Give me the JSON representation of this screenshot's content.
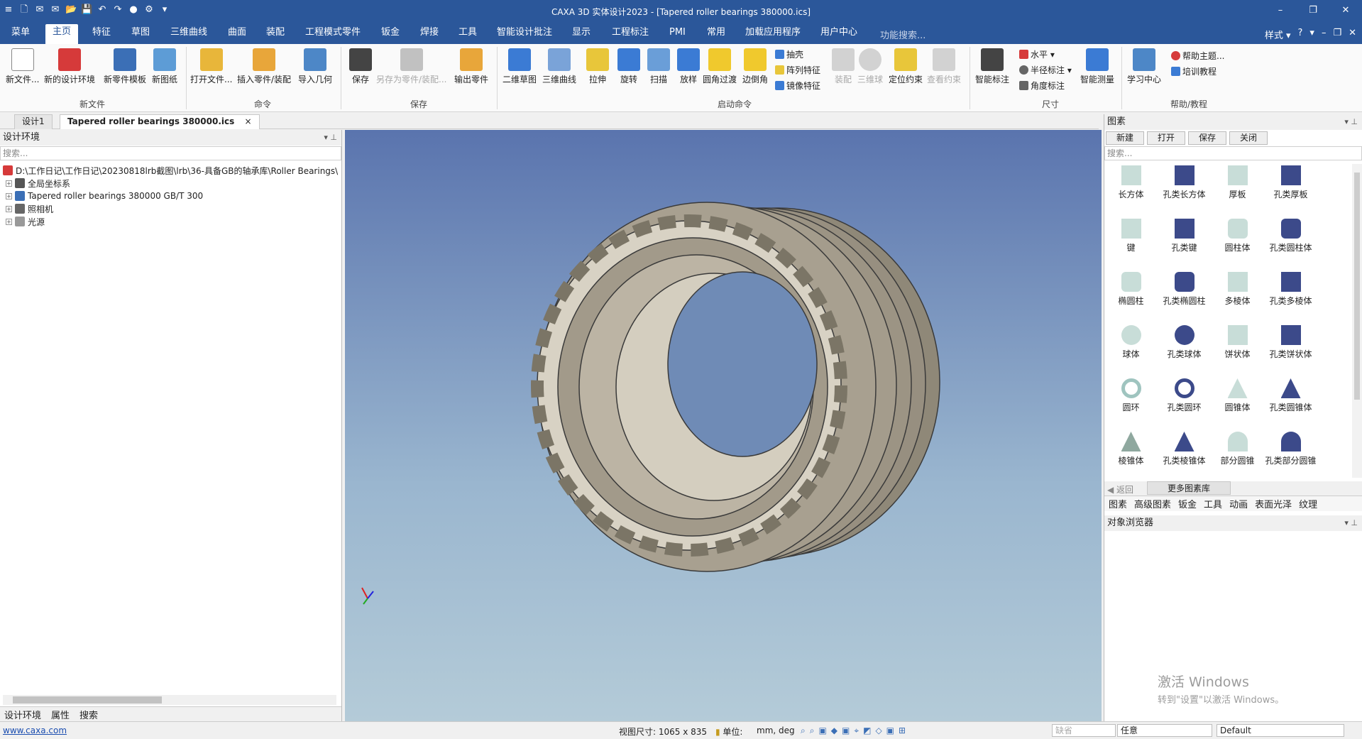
{
  "window": {
    "title": "CAXA 3D 实体设计2023 - [Tapered roller bearings 380000.ics]",
    "min_glyph": "–",
    "restore_glyph": "❐",
    "close_glyph": "✕"
  },
  "quick_access": [
    "≡",
    "🗋",
    "✉",
    "✉",
    "📂",
    "💾",
    "↶",
    "↷",
    "●",
    "⚙",
    "▾"
  ],
  "menu": {
    "tabs": [
      "菜单",
      "主页",
      "特征",
      "草图",
      "三维曲线",
      "曲面",
      "装配",
      "工程模式零件",
      "钣金",
      "焊接",
      "工具",
      "智能设计批注",
      "显示",
      "工程标注",
      "PMI",
      "常用",
      "加载应用程序",
      "用户中心"
    ],
    "active_index": 1,
    "search_placeholder": "功能搜索...",
    "right": [
      "样式 ▾",
      "?",
      "▾",
      "–",
      "❐",
      "✕"
    ]
  },
  "ribbon": {
    "groups": {
      "new": "新文件",
      "command": "命令",
      "save": "保存",
      "launch": "启动命令",
      "dimension": "尺寸",
      "help": "帮助/教程"
    },
    "new_file": "新文件...",
    "new_design_env": "新的设计环境",
    "new_part_template": "新零件模板",
    "new_drawing": "新图纸",
    "open_file": "打开文件...",
    "insert_part": "插入零件/装配",
    "import_geometry": "导入几何",
    "save": "保存",
    "save_as_part": "另存为零件/装配...",
    "export_part": "输出零件",
    "sketch_2d": "二维草图",
    "curve_3d": "三维曲线",
    "extrude": "拉伸",
    "revolve": "旋转",
    "sweep": "扫描",
    "loft": "放样",
    "fillet": "圆角过渡",
    "chamfer": "边倒角",
    "shell": "抽壳",
    "pattern": "阵列特征",
    "mirror": "镜像特征",
    "assembly": "装配",
    "trackball": "三维球",
    "locate": "定位约束",
    "view_constraint": "查看约束",
    "smart_dim": "智能标注",
    "horizontal": "水平 ▾",
    "radius_dim": "半径标注 ▾",
    "angle_dim": "角度标注",
    "smart_measure": "智能测量",
    "learning_center": "学习中心",
    "help_topics": "帮助主题...",
    "training": "培训教程"
  },
  "doc_tabs": [
    "设计1",
    "Tapered roller bearings 380000.ics"
  ],
  "doc_tab_close": "×",
  "left_panel": {
    "title": "设计环境",
    "search_placeholder": "搜索...",
    "tree": [
      {
        "label": "D:\\工作日记\\工作日记\\20230818lrb截图\\lrb\\36-具备GB的轴承库\\Roller Bearings\\",
        "icon": "caxa-icon"
      },
      {
        "label": "全局坐标系",
        "icon": "axes-icon"
      },
      {
        "label": "Tapered roller bearings 380000 GB/T 300",
        "icon": "part-icon"
      },
      {
        "label": "照相机",
        "icon": "camera-icon"
      },
      {
        "label": "光源",
        "icon": "light-icon"
      }
    ],
    "bottom_tabs": [
      "设计环境",
      "属性",
      "搜索"
    ]
  },
  "right_panel": {
    "title": "图素",
    "toolbar": [
      "新建",
      "打开",
      "保存",
      "关闭"
    ],
    "search_placeholder": "搜索...",
    "shapes": [
      "长方体",
      "孔类长方体",
      "厚板",
      "孔类厚板",
      "键",
      "孔类键",
      "圆柱体",
      "孔类圆柱体",
      "椭圆柱",
      "孔类椭圆柱",
      "多棱体",
      "孔类多棱体",
      "球体",
      "孔类球体",
      "饼状体",
      "孔类饼状体",
      "圆环",
      "孔类圆环",
      "圆锥体",
      "孔类圆锥体",
      "棱锥体",
      "孔类棱锥体",
      "部分圆锥",
      "孔类部分圆锥"
    ],
    "nav_back": "返回",
    "more_library": "更多图素库",
    "tabs": [
      "图素",
      "高级图素",
      "钣金",
      "工具",
      "动画",
      "表面光泽",
      "纹理"
    ],
    "object_browser": "对象浏览器",
    "watermark_title": "激活 Windows",
    "watermark_sub": "转到\"设置\"以激活 Windows。"
  },
  "status": {
    "url": "www.caxa.com",
    "view_size": "视图尺寸: 1065 x  835",
    "unit_label": "单位:",
    "unit_value": "mm, deg",
    "box1": "缺省",
    "box2": "任意",
    "box3": "Default"
  },
  "colors": {
    "title_blue": "#2b579a",
    "bearing": "#a49c8c",
    "viewport_top": "#5a74ae",
    "viewport_bottom": "#b4cbd8"
  }
}
